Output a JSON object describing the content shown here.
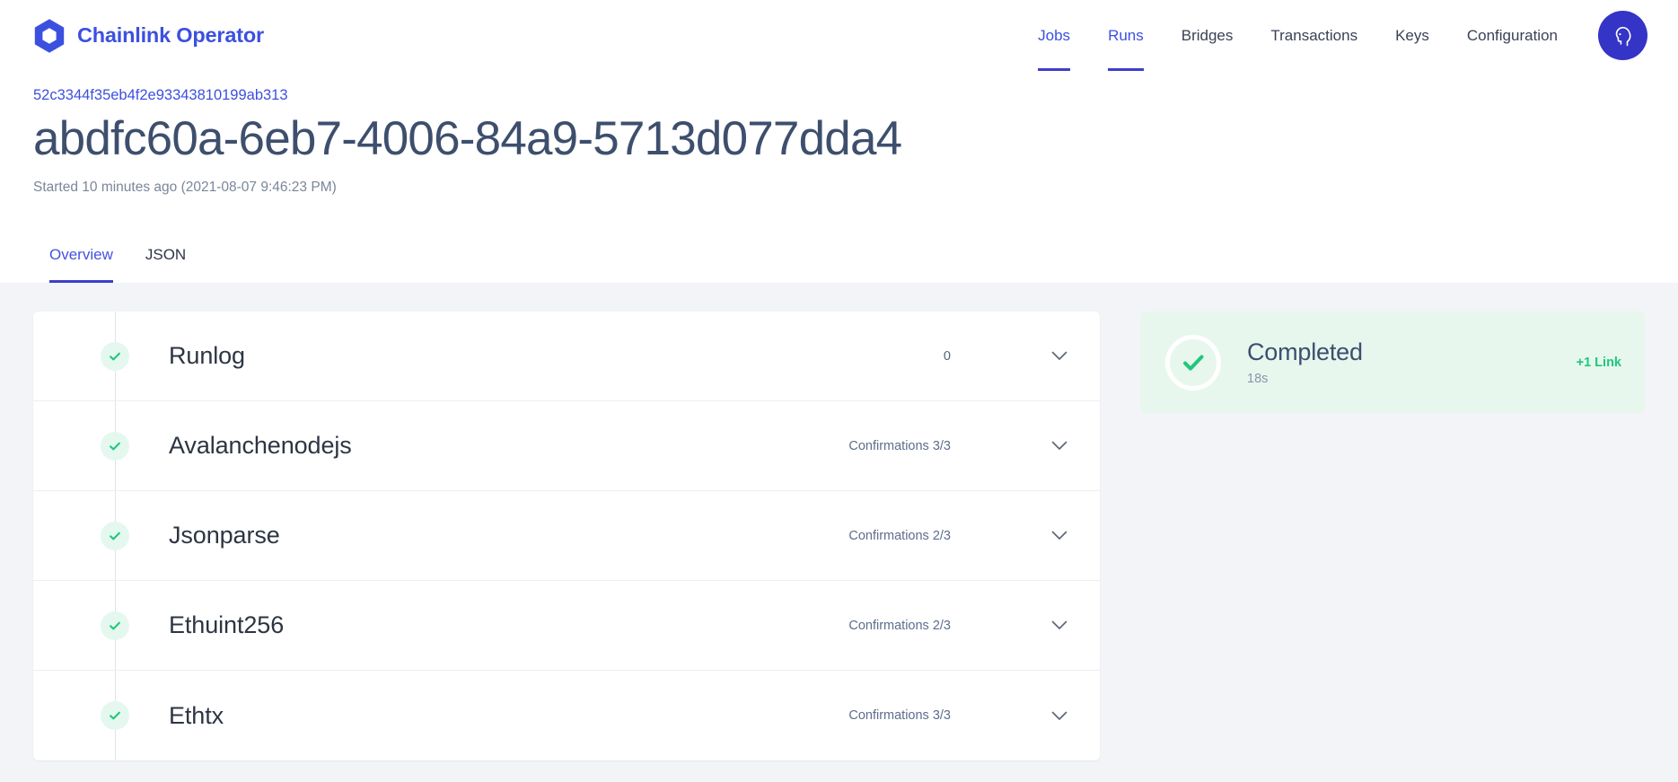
{
  "brand": {
    "name": "Chainlink Operator",
    "logo_icon": "chainlink-hexagon-icon",
    "color": "#3c50e0"
  },
  "nav": {
    "items": [
      {
        "label": "Jobs",
        "active": true
      },
      {
        "label": "Runs",
        "active": true
      },
      {
        "label": "Bridges",
        "active": false
      },
      {
        "label": "Transactions",
        "active": false
      },
      {
        "label": "Keys",
        "active": false
      },
      {
        "label": "Configuration",
        "active": false
      }
    ],
    "avatar_icon": "user-profile-icon",
    "avatar_color": "#3434c6"
  },
  "header": {
    "breadcrumb": "52c3344f35eb4f2e93343810199ab313",
    "title": "abdfc60a-6eb7-4006-84a9-5713d077dda4",
    "subtitle": "Started 10 minutes ago (2021-08-07 9:46:23 PM)"
  },
  "tabs": [
    {
      "label": "Overview",
      "active": true
    },
    {
      "label": "JSON",
      "active": false
    }
  ],
  "tasks": [
    {
      "name": "Runlog",
      "meta": "0",
      "status_icon": "check-icon",
      "chevron_icon": "chevron-down-icon"
    },
    {
      "name": "Avalanchenodejs",
      "meta": "Confirmations 3/3",
      "status_icon": "check-icon",
      "chevron_icon": "chevron-down-icon"
    },
    {
      "name": "Jsonparse",
      "meta": "Confirmations 2/3",
      "status_icon": "check-icon",
      "chevron_icon": "chevron-down-icon"
    },
    {
      "name": "Ethuint256",
      "meta": "Confirmations 2/3",
      "status_icon": "check-icon",
      "chevron_icon": "chevron-down-icon"
    },
    {
      "name": "Ethtx",
      "meta": "Confirmations 3/3",
      "status_icon": "check-icon",
      "chevron_icon": "chevron-down-icon"
    }
  ],
  "status_card": {
    "title": "Completed",
    "duration": "18s",
    "badge": "+1 Link",
    "icon": "check-circle-icon",
    "background": "#e7f7ee",
    "accent": "#1fc77a"
  }
}
